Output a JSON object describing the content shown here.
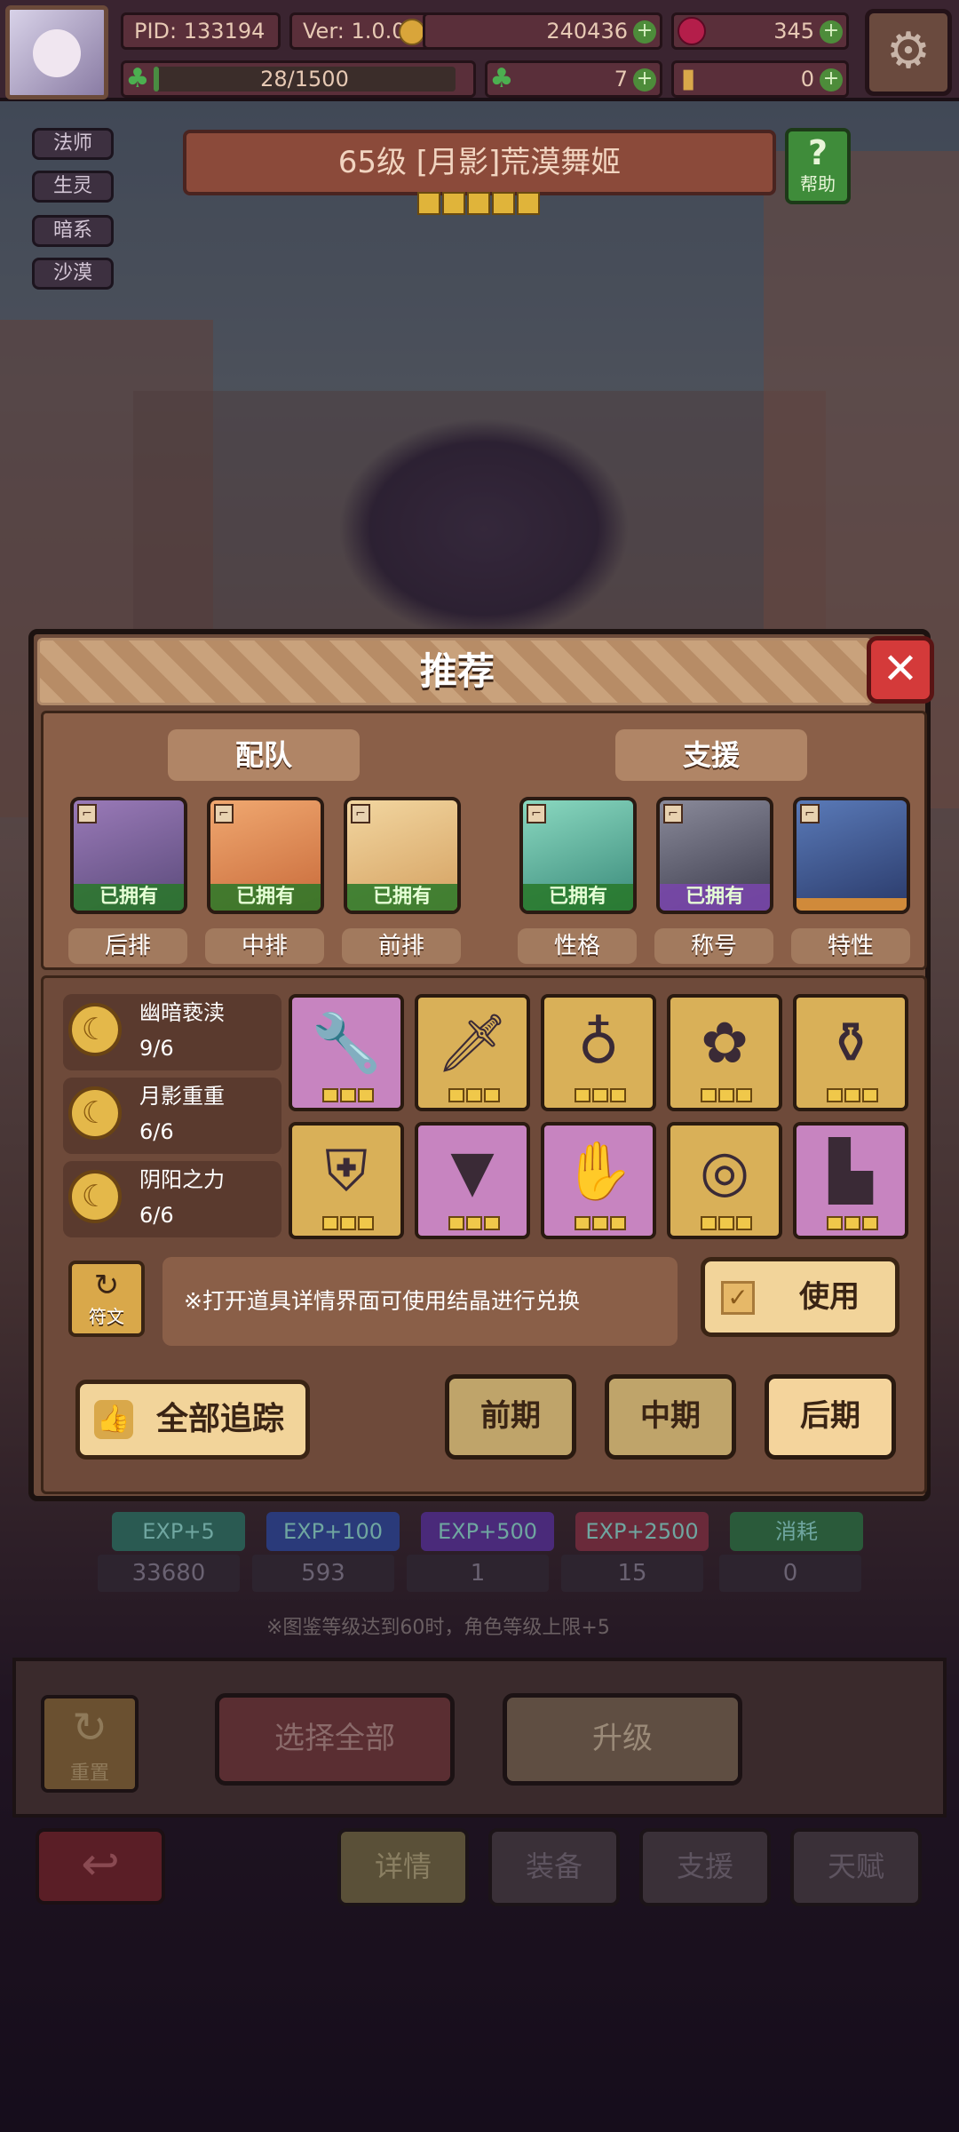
{
  "player": {
    "pid": "PID: 133194",
    "version": "Ver: 1.0.0.0",
    "gold": "240436",
    "gems": "345",
    "stamina": "28/1500",
    "stamina_fraction": 0.0187,
    "clover": "7",
    "tickets": "0"
  },
  "character": {
    "title": "65级 [月影]荒漠舞姬",
    "star_count": 5,
    "tags": [
      "法师",
      "生灵",
      "暗系",
      "沙漠"
    ],
    "help_label": "帮助"
  },
  "modal": {
    "title": "推荐",
    "team_label": "配队",
    "support_label": "支援",
    "owned_label": "已拥有",
    "team": [
      {
        "role": "后排",
        "owned": true
      },
      {
        "role": "中排",
        "owned": true
      },
      {
        "role": "前排",
        "owned": true
      }
    ],
    "support": [
      {
        "role": "性格",
        "owned": true
      },
      {
        "role": "称号",
        "owned": true
      },
      {
        "role": "特性",
        "owned": false
      }
    ],
    "sets": [
      {
        "name": "幽暗亵渎",
        "count": "9/6"
      },
      {
        "name": "月影重重",
        "count": "6/6"
      },
      {
        "name": "阴阳之力",
        "count": "6/6"
      }
    ],
    "items": [
      {
        "icon": "wrench-icon",
        "rarity": "pink",
        "stars": 3
      },
      {
        "icon": "sword-icon",
        "rarity": "gold",
        "stars": 3
      },
      {
        "icon": "necklace-icon",
        "rarity": "gold",
        "stars": 3
      },
      {
        "icon": "flower-icon",
        "rarity": "gold",
        "stars": 3
      },
      {
        "icon": "potion-icon",
        "rarity": "gold",
        "stars": 3
      },
      {
        "icon": "armor-icon",
        "rarity": "gold",
        "stars": 3
      },
      {
        "icon": "vest-icon",
        "rarity": "pink",
        "stars": 3
      },
      {
        "icon": "glove-icon",
        "rarity": "pink",
        "stars": 3
      },
      {
        "icon": "ring-icon",
        "rarity": "gold",
        "stars": 3
      },
      {
        "icon": "boots-icon",
        "rarity": "pink",
        "stars": 3
      }
    ],
    "rune_label": "符文",
    "hint": "※打开道具详情界面可使用结晶进行兑换",
    "use_label": "使用",
    "track_all_label": "全部追踪",
    "phases": [
      "前期",
      "中期",
      "后期"
    ],
    "active_phase": "后期"
  },
  "background": {
    "exp_items": [
      "EXP+5",
      "EXP+100",
      "EXP+500",
      "EXP+2500",
      "消耗"
    ],
    "exp_counts": [
      "33680",
      "593",
      "1",
      "15",
      "0"
    ],
    "note": "※图鉴等级达到60时，角色等级上限+5",
    "reset_label": "重置",
    "select_all_label": "选择全部",
    "upgrade_label": "升级",
    "tabs": [
      "详情",
      "装备",
      "支援",
      "天赋"
    ]
  },
  "colors": {
    "modal_bg": "#6b4a3a",
    "owned_green": "#287828",
    "close_red": "#d43a3a",
    "gold_slot": "#d9b058",
    "pink_slot": "#c784c0"
  }
}
